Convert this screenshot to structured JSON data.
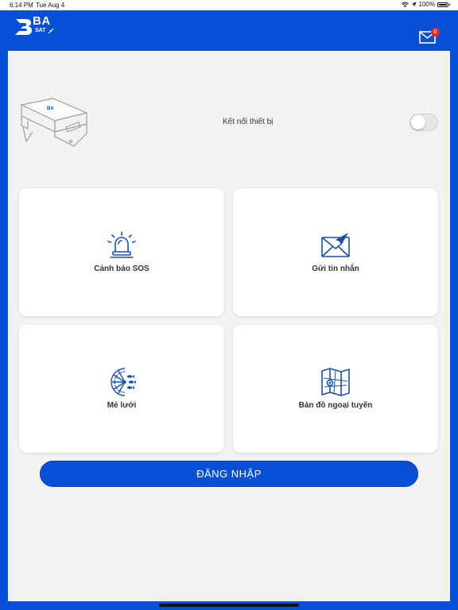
{
  "status_bar": {
    "time": "6:14 PM",
    "date": "Tue Aug 4",
    "battery": "100%"
  },
  "header": {
    "logo_primary": "BA",
    "logo_secondary": "SAT",
    "mail_badge_count": "0"
  },
  "device": {
    "connect_label": "Kết nối thiết bị",
    "connected": false
  },
  "menu": {
    "items": [
      {
        "label": "Cảnh báo SOS",
        "icon": "sos-alarm-icon"
      },
      {
        "label": "Gửi tin nhắn",
        "icon": "send-message-icon"
      },
      {
        "label": "Mẻ lưới",
        "icon": "fishing-net-icon"
      },
      {
        "label": "Bản đồ ngoại tuyến",
        "icon": "offline-map-icon"
      }
    ]
  },
  "login": {
    "label": "ĐĂNG NHẬP"
  },
  "colors": {
    "primary": "#0650d6",
    "panel": "#f2f2f2",
    "badge": "#e62828",
    "icon": "#1c4fa8"
  }
}
